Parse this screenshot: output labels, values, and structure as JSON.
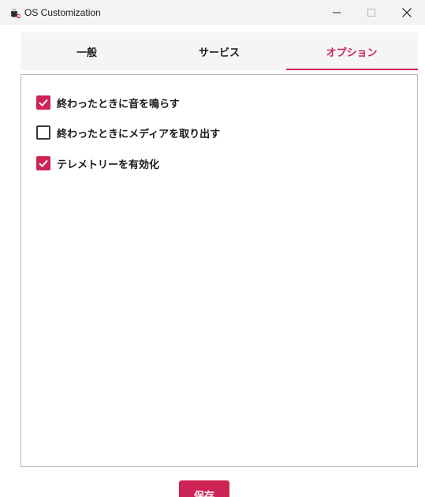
{
  "window": {
    "title": "OS Customization",
    "icon": "raspberry-pi-icon",
    "controls": [
      "minimize-icon",
      "maximize-icon",
      "close-icon"
    ]
  },
  "tabs": [
    {
      "label": "一般",
      "active": false
    },
    {
      "label": "サービス",
      "active": false
    },
    {
      "label": "オプション",
      "active": true
    }
  ],
  "options": [
    {
      "label": "終わったときに音を鳴らす",
      "checked": true
    },
    {
      "label": "終わったときにメディアを取り出す",
      "checked": false
    },
    {
      "label": "テレメトリーを有効化",
      "checked": true
    }
  ],
  "actions": {
    "save_label": "保存"
  },
  "colors": {
    "accent": "#cd2355",
    "titlebar": "#f3f3f3",
    "tabbar": "#f5f5f5",
    "panel_border": "#b9b9b9"
  }
}
